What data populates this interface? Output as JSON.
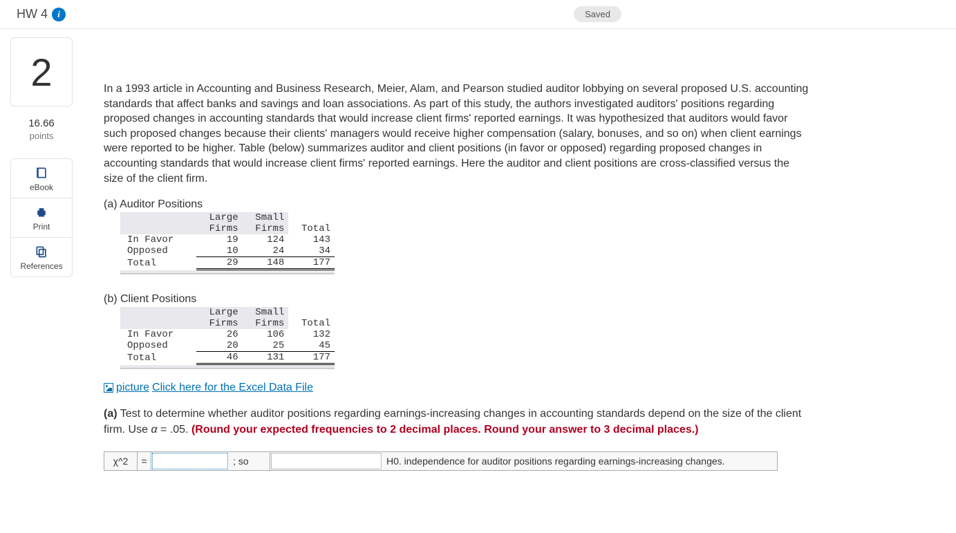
{
  "header": {
    "title": "HW 4",
    "status": "Saved"
  },
  "sidebar": {
    "question_number": "2",
    "points_value": "16.66",
    "points_label": "points",
    "tools": {
      "ebook": "eBook",
      "print": "Print",
      "references": "References"
    }
  },
  "intro": "In a 1993 article in Accounting and Business Research, Meier, Alam, and Pearson studied auditor lobbying on several proposed U.S. accounting standards that affect banks and savings and loan associations. As part of this study, the authors investigated auditors' positions regarding proposed changes in accounting standards that would increase client firms' reported earnings. It was hypothesized that auditors would favor such proposed changes because their clients' managers would receive higher compensation (salary, bonuses, and so on) when client earnings were reported to be higher. Table (below) summarizes auditor and client positions (in favor or opposed) regarding proposed changes in accounting standards that would increase client firms' reported earnings. Here the auditor and client positions are cross-classified versus the size of the client firm.",
  "tables": {
    "a_label": "(a) Auditor Positions",
    "b_label": "(b) Client Positions",
    "headers": {
      "c1": "Large",
      "c1b": "Firms",
      "c2": "Small",
      "c2b": "Firms",
      "c3": "Total"
    },
    "rows": {
      "r1": "In Favor",
      "r2": "Opposed",
      "r3": "Total"
    },
    "a": {
      "r1": {
        "large": "19",
        "small": "124",
        "total": "143"
      },
      "r2": {
        "large": "10",
        "small": "24",
        "total": "34"
      },
      "r3": {
        "large": "29",
        "small": "148",
        "total": "177"
      }
    },
    "b": {
      "r1": {
        "large": "26",
        "small": "106",
        "total": "132"
      },
      "r2": {
        "large": "20",
        "small": "25",
        "total": "45"
      },
      "r3": {
        "large": "46",
        "small": "131",
        "total": "177"
      }
    }
  },
  "link": {
    "alt": "picture",
    "text": "Click here for the Excel Data File"
  },
  "question_a": {
    "label": "(a)",
    "text1": " Test to determine whether auditor positions regarding earnings-increasing changes in accounting standards depend on the size of the client firm. Use ",
    "alpha": "α",
    "text2": " = .05. ",
    "red": "(Round your expected frequencies to 2 decimal places. Round your answer to 3 decimal places.)"
  },
  "answer": {
    "chi": "χ^2",
    "eq": "=",
    "so": "; so",
    "tail": "H0. independence for auditor positions regarding earnings-increasing changes."
  }
}
